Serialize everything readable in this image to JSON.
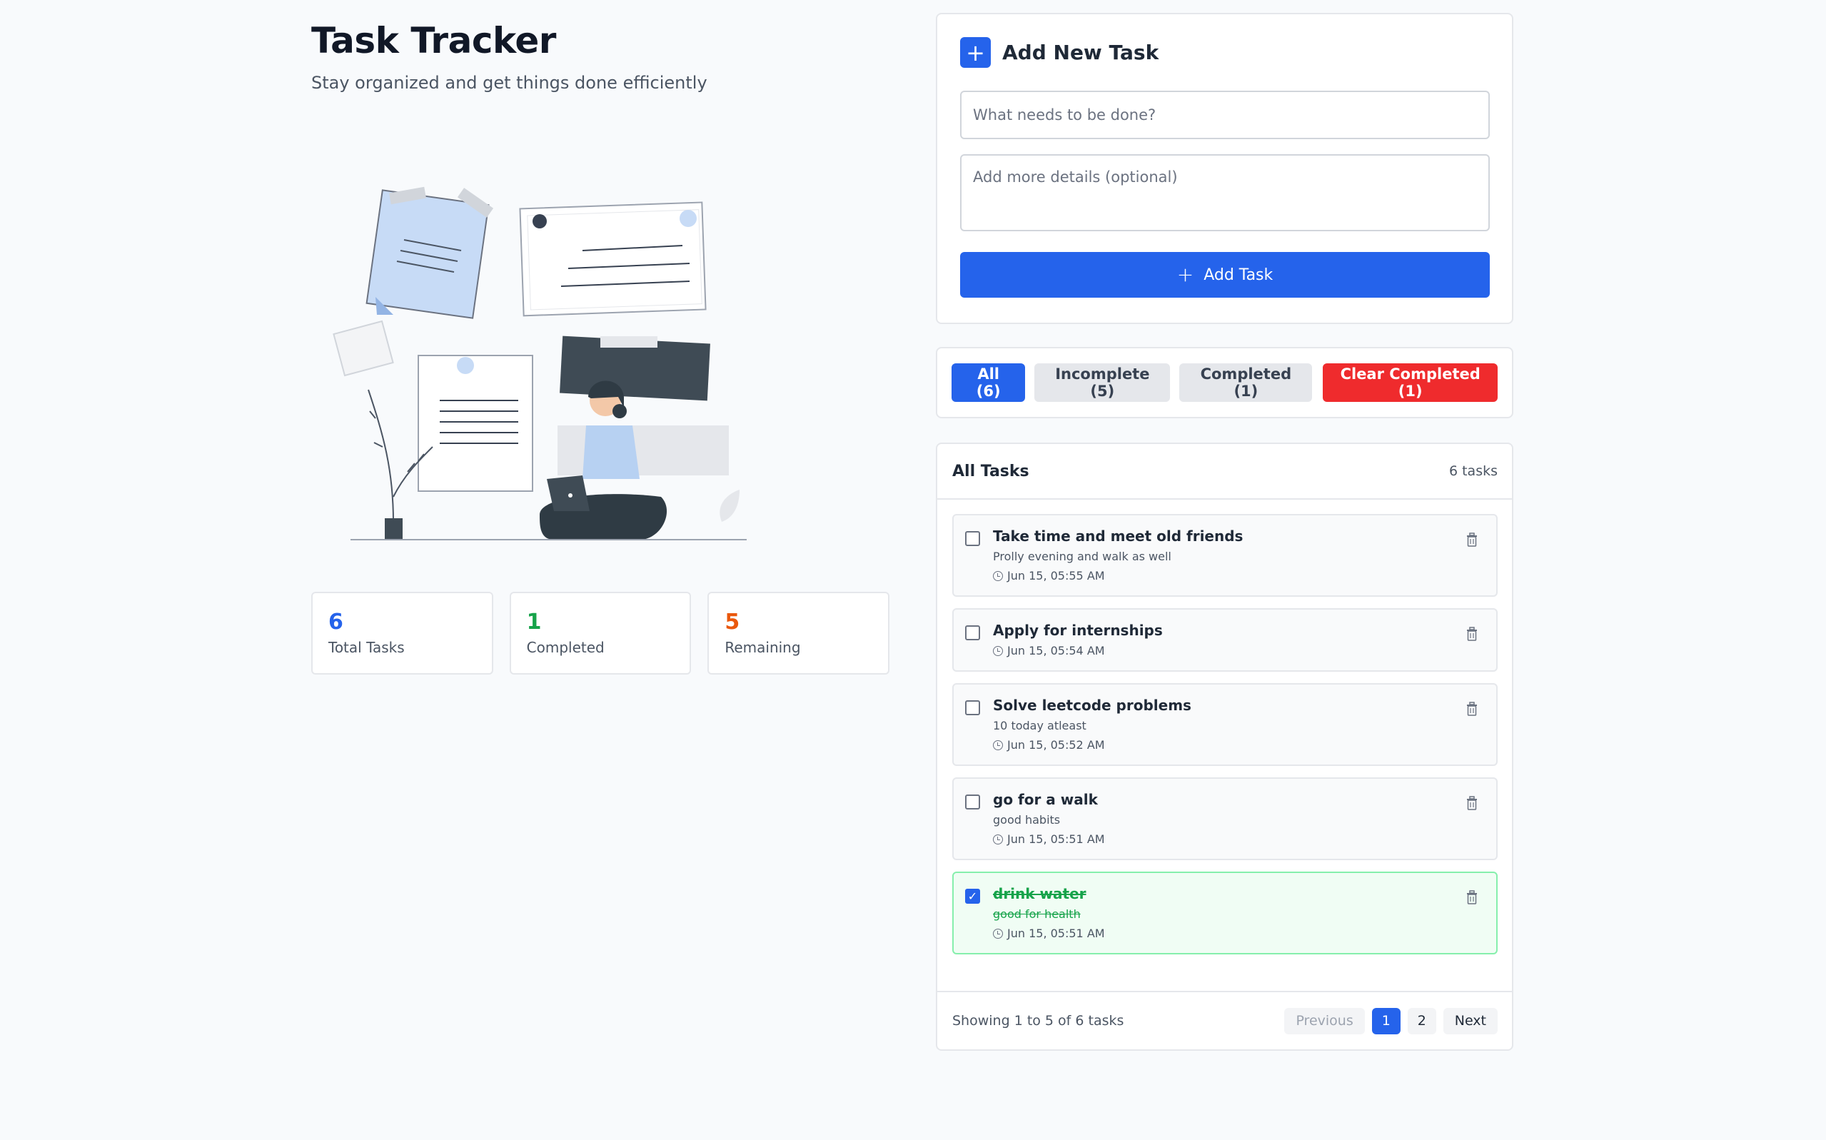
{
  "header": {
    "title": "Task Tracker",
    "subtitle": "Stay organized and get things done efficiently"
  },
  "illustration": {
    "icon": "person-working-laptop-illustration"
  },
  "stats": [
    {
      "value": "6",
      "label": "Total Tasks",
      "color": "#2563eb"
    },
    {
      "value": "1",
      "label": "Completed",
      "color": "#16a34a"
    },
    {
      "value": "5",
      "label": "Remaining",
      "color": "#ea580c"
    }
  ],
  "add_task": {
    "title": "Add New Task",
    "icon": "plus-icon",
    "title_placeholder": "What needs to be done?",
    "details_placeholder": "Add more details (optional)",
    "button_label": "Add Task"
  },
  "filters": {
    "all": "All (6)",
    "incomplete": "Incomplete (5)",
    "completed": "Completed (1)",
    "clear": "Clear Completed (1)",
    "active": "all"
  },
  "list": {
    "title": "All Tasks",
    "count": "6 tasks",
    "tasks": [
      {
        "title": "Take time and meet old friends",
        "description": "Prolly evening and walk as well",
        "time": "Jun 15, 05:55 AM",
        "completed": false
      },
      {
        "title": "Apply for internships",
        "description": "",
        "time": "Jun 15, 05:54 AM",
        "completed": false
      },
      {
        "title": "Solve leetcode problems",
        "description": "10 today atleast",
        "time": "Jun 15, 05:52 AM",
        "completed": false
      },
      {
        "title": "go for a walk",
        "description": "good habits",
        "time": "Jun 15, 05:51 AM",
        "completed": false
      },
      {
        "title": "drink water",
        "description": "good for health",
        "time": "Jun 15, 05:51 AM",
        "completed": true
      }
    ]
  },
  "pagination": {
    "showing": "Showing 1 to 5 of 6 tasks",
    "previous": "Previous",
    "next": "Next",
    "pages": [
      "1",
      "2"
    ],
    "current": "1"
  },
  "colors": {
    "primary": "#2563eb",
    "danger": "#ef2b2d",
    "success": "#16a34a",
    "warning": "#ea580c"
  }
}
